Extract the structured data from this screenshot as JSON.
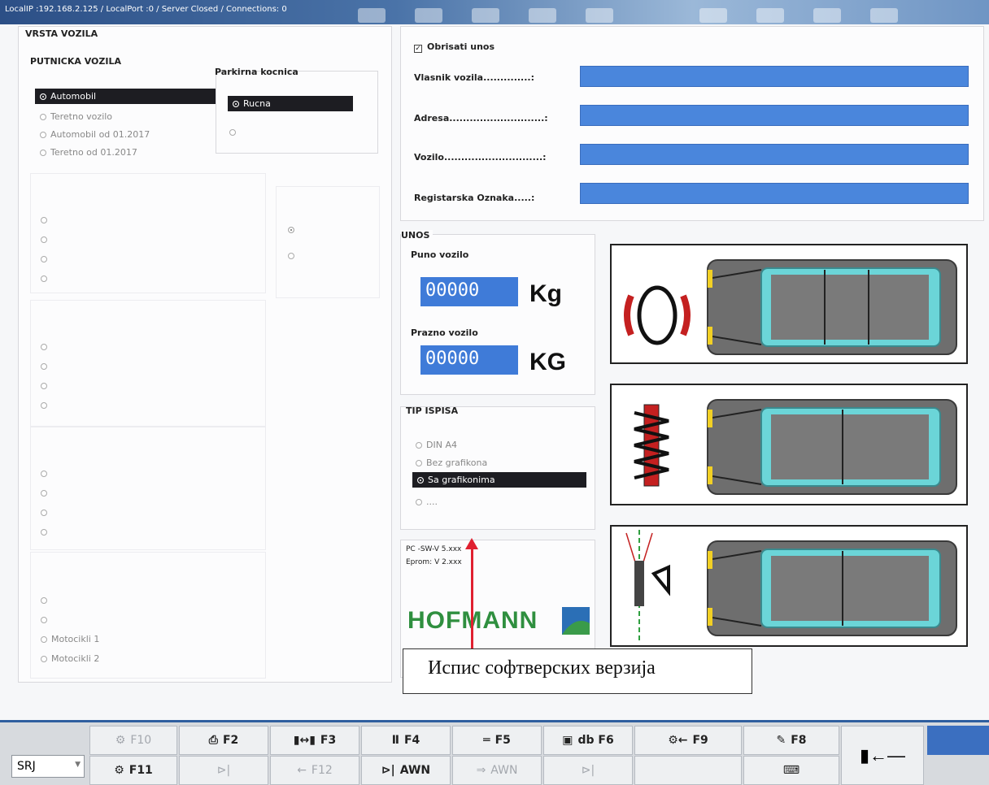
{
  "window": {
    "status": "LocalIP :192.168.2.125 / LocalPort :0 / Server Closed / Connections: 0"
  },
  "vehicle_type": {
    "title": "VRSTA VOZILA",
    "group_title": "PUTNICKA VOZILA",
    "options": [
      "Automobil",
      "Teretno vozilo",
      "Automobil od 01.2017",
      "Teretno od 01.2017"
    ],
    "selected": "Automobil",
    "parking_brake": {
      "title": "Parkirna kocnica",
      "options": [
        "Rucna",
        ""
      ],
      "selected": "Rucna"
    },
    "moto_options": [
      "Motocikli 1",
      "Motocikli 2"
    ]
  },
  "owner": {
    "clear_checkbox": "Obrisati unos",
    "fields": [
      {
        "label": "Vlasnik vozila..............:",
        "value": ""
      },
      {
        "label": "Adresa............................:",
        "value": ""
      },
      {
        "label": "Vozilo.............................:",
        "value": ""
      },
      {
        "label": "Registarska Oznaka.....:",
        "value": ""
      }
    ]
  },
  "entry": {
    "title": "UNOS",
    "full_label": "Puno vozilo",
    "full_value": "00000",
    "full_unit": "Kg",
    "empty_label": "Prazno vozilo",
    "empty_value": "00000",
    "empty_unit": "KG"
  },
  "print_type": {
    "title": "TIP ISPISA",
    "options": [
      "DIN A4",
      "Bez grafikona",
      "Sa grafikonima",
      "...."
    ],
    "selected": "Sa grafikonima"
  },
  "version": {
    "pc_line": "PC -SW-V 5.xxx",
    "eprom_line": "Eprom: V 2.xxx",
    "brand": "HOFMANN"
  },
  "annotation": "Испис софтверских верзија",
  "language": "SRJ",
  "fkeys_row1": [
    "F10",
    "F2",
    "F3",
    "F4",
    "F5",
    "db F6",
    "F9",
    "F8"
  ],
  "fkeys_row2": [
    "F11",
    "",
    "F12",
    "AWN",
    "AWN",
    "",
    "",
    ""
  ],
  "icons": {
    "brake": "tire-icon",
    "suspension": "spring-icon",
    "alignment": "wheel-alignment-icon",
    "exit": "exit-icon"
  },
  "colors": {
    "input_blue": "#4a86dc",
    "selected_dark": "#1d1d22",
    "accent_red": "#e02030",
    "brand_green": "#2f8f3f"
  }
}
